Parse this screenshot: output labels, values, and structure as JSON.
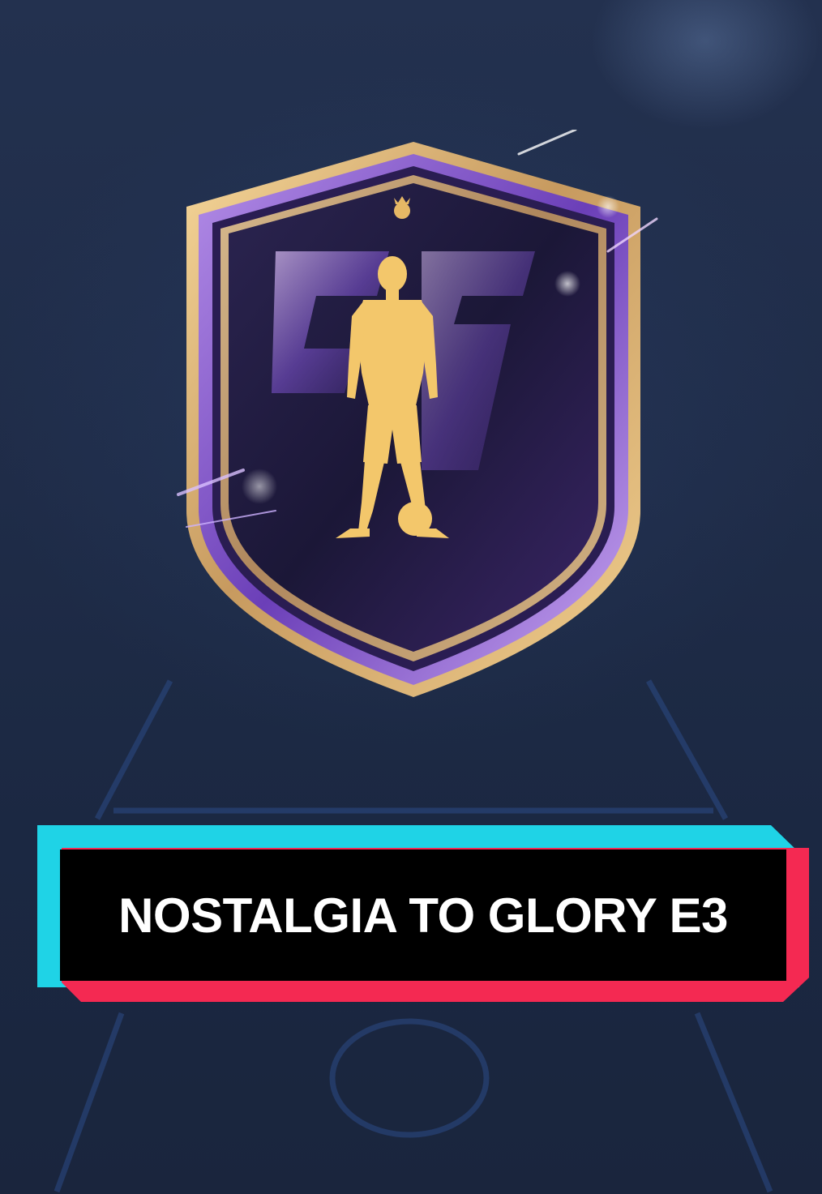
{
  "banner": {
    "title": "NOSTALGIA TO GLORY E3"
  },
  "badge": {
    "icon": "player-silhouette-icon",
    "crest_icon": "crown-crest-icon",
    "colors": {
      "frame_gold": "#e8c07a",
      "frame_purple": "#8a5bd6",
      "inner_dark": "#1d1838",
      "silhouette_gold": "#f3c76b"
    }
  },
  "colors": {
    "background": "#1f2c48",
    "banner_cyan": "#1fd3e6",
    "banner_red": "#f42952",
    "banner_black": "#000000",
    "banner_text": "#ffffff"
  }
}
